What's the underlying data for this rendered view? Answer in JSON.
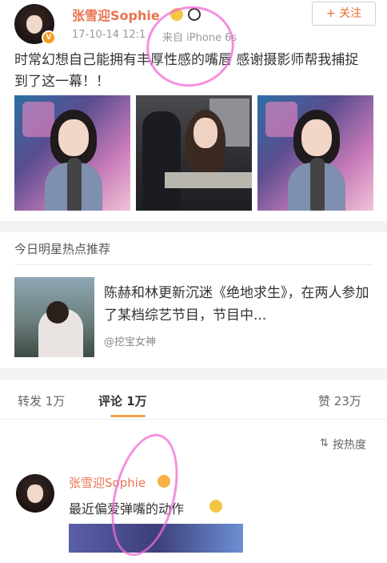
{
  "post": {
    "author": "张雪迎Sophie",
    "time": "17-10-14 12:1",
    "source": "来自 iPhone 6s",
    "follow_label": "+ 关注",
    "text": "时常幻想自己能拥有丰厚性感的嘴唇 感谢摄影师帮我捕捉到了这一幕！！"
  },
  "recommend": {
    "section_title": "今日明星热点推荐",
    "article_title": "陈赫和林更新沉迷《绝地求生》，在两人参加了某档综艺节目，节目中...",
    "article_source": "@挖宝女神"
  },
  "tabs": {
    "repost": "转发 1万",
    "comment": "评论 1万",
    "like": "赞 23万"
  },
  "sort_label": "按热度",
  "comment": {
    "author": "张雪迎Sophie",
    "text": "最近偏爱弹嘴的动作"
  },
  "colors": {
    "name": "#eb7350",
    "accent": "#f7a44a",
    "annotation": "#f06ad6"
  }
}
